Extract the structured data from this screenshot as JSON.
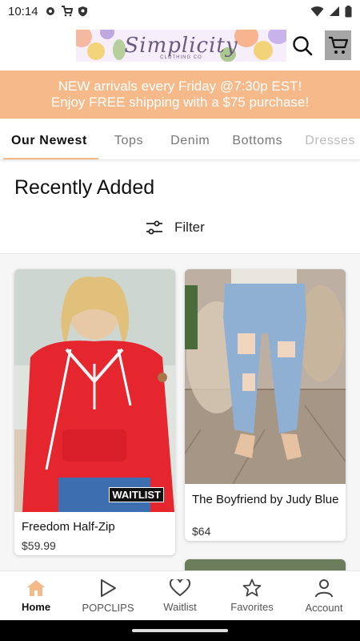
{
  "status_bar": {
    "time": "10:14"
  },
  "brand": {
    "logo_text": "Simplicity",
    "logo_subtext": "CLOTHING CO"
  },
  "promo": {
    "line1": "NEW arrivals every Friday @7:30p EST!",
    "line2": "Enjoy FREE shipping with a $75 purchase!"
  },
  "tabs": [
    {
      "label": "Our Newest",
      "active": true
    },
    {
      "label": "Tops"
    },
    {
      "label": "Denim"
    },
    {
      "label": "Bottoms"
    },
    {
      "label": "Dresses"
    }
  ],
  "section": {
    "title": "Recently Added",
    "filter_label": "Filter"
  },
  "products": [
    {
      "name": "Freedom Half-Zip",
      "price": "$59.99",
      "badge": "WAITLIST"
    },
    {
      "name": "The Boyfriend by Judy Blue",
      "price": "$64"
    }
  ],
  "bottom_nav": [
    {
      "label": "Home",
      "icon": "home-icon",
      "active": true
    },
    {
      "label": "POPCLIPS",
      "icon": "play-icon"
    },
    {
      "label": "Waitlist",
      "icon": "heart-icon"
    },
    {
      "label": "Favorites",
      "icon": "star-icon"
    },
    {
      "label": "Account",
      "icon": "account-icon"
    }
  ],
  "colors": {
    "accent": "#f5b98a",
    "cart_bg": "#a6a6a6",
    "home_icon": "#f5b98a"
  }
}
